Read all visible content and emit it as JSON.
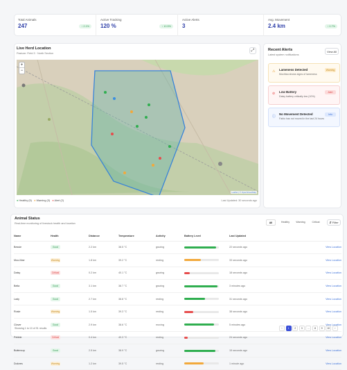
{
  "stats": [
    {
      "label": "Total Animals",
      "value": "247",
      "change": "↑ 2.1%"
    },
    {
      "label": "Active Tracking",
      "value": "120 %",
      "change": "↑ 10.5%"
    },
    {
      "label": "Active Alerts",
      "value": "3",
      "change": ""
    },
    {
      "label": "Avg. Movement",
      "value": "2.4 km",
      "change": "↑ 0.7%"
    }
  ],
  "map": {
    "title": "Live Herd Location",
    "subtitle": "Pasture: Field 3 · North Section",
    "zoom_in": "+",
    "zoom_out": "−",
    "attribution": "Leaflet | © OpenStreetMap",
    "legend": [
      {
        "label": "Healthy (5)",
        "color": "#2fae4f"
      },
      {
        "label": "Warning (3)",
        "color": "#f2a93b"
      },
      {
        "label": "Alert (2)",
        "color": "#e74c4c"
      }
    ],
    "updated": "Last Updated: 30 seconds ago"
  },
  "alerts": {
    "title": "Recent Alerts",
    "subtitle": "Latest system notifications",
    "view_all": "View All",
    "items": [
      {
        "title": "Lameness Detected",
        "desc": "Mochtsa shows signs of lameness",
        "badge": "Warning",
        "icon": "warning-icon"
      },
      {
        "title": "Low Battery",
        "desc": "Daisy battery critically low (10%)",
        "badge": "Alert",
        "icon": "battery-icon"
      },
      {
        "title": "No Movement Detected",
        "desc": "Fabio has not moved in the last 24 hours",
        "badge": "Info",
        "icon": "info-icon"
      }
    ]
  },
  "table": {
    "title": "Animal Status",
    "subtitle": "Real-time monitoring of livestock health and location",
    "tabs": [
      "All",
      "Healthy",
      "Warning",
      "Critical"
    ],
    "filter": "Filter",
    "headers": [
      "Name",
      "Health",
      "Distance",
      "Temperature",
      "Activity",
      "Battery Level",
      "Last Updated",
      ""
    ],
    "rows": [
      {
        "name": "Bessie",
        "health": "Good",
        "distance": "2.2 km",
        "temp": "38.5 °C",
        "activity": "grazing",
        "battery": 0.92,
        "updated": "22 seconds ago",
        "action": "View Location"
      },
      {
        "name": "Moo-Mae",
        "health": "Warning",
        "distance": "1.8 km",
        "temp": "39.2 °C",
        "activity": "resting",
        "battery": 0.48,
        "updated": "33 seconds ago",
        "action": "View Location"
      },
      {
        "name": "Daisy",
        "health": "Critical",
        "distance": "0.2 km",
        "temp": "40.1 °C",
        "activity": "grazing",
        "battery": 0.15,
        "updated": "18 seconds ago",
        "action": "View Location"
      },
      {
        "name": "Bella",
        "health": "Good",
        "distance": "3.1 km",
        "temp": "38.7 °C",
        "activity": "grazing",
        "battery": 0.95,
        "updated": "3 minutes ago",
        "action": "View Location"
      },
      {
        "name": "Lady",
        "health": "Good",
        "distance": "2.7 km",
        "temp": "38.8 °C",
        "activity": "resting",
        "battery": 0.6,
        "updated": "31 seconds ago",
        "action": "View Location"
      },
      {
        "name": "Rosie",
        "health": "Warning",
        "distance": "1.5 km",
        "temp": "39.3 °C",
        "activity": "resting",
        "battery": 0.25,
        "updated": "38 seconds ago",
        "action": "View Location"
      },
      {
        "name": "Clover",
        "health": "Good",
        "distance": "2.9 km",
        "temp": "38.6 °C",
        "activity": "moving",
        "battery": 0.85,
        "updated": "5 minutes ago",
        "action": "View Location"
      },
      {
        "name": "Pebble",
        "health": "Critical",
        "distance": "0.4 km",
        "temp": "40.3 °C",
        "activity": "resting",
        "battery": 0.1,
        "updated": "24 seconds ago",
        "action": "View Location"
      },
      {
        "name": "Buttercup",
        "health": "Good",
        "distance": "2.5 km",
        "temp": "38.9 °C",
        "activity": "grazing",
        "battery": 0.9,
        "updated": "15 seconds ago",
        "action": "View Location"
      },
      {
        "name": "Dolores",
        "health": "Warning",
        "distance": "1.2 km",
        "temp": "39.5 °C",
        "activity": "resting",
        "battery": 0.55,
        "updated": "1 minute ago",
        "action": "View Location"
      }
    ],
    "showing": "Showing 1 to 10 of 91 results",
    "pages": [
      "‹",
      "1",
      "2",
      "3",
      "…",
      "8",
      "9",
      "10",
      "›"
    ]
  }
}
